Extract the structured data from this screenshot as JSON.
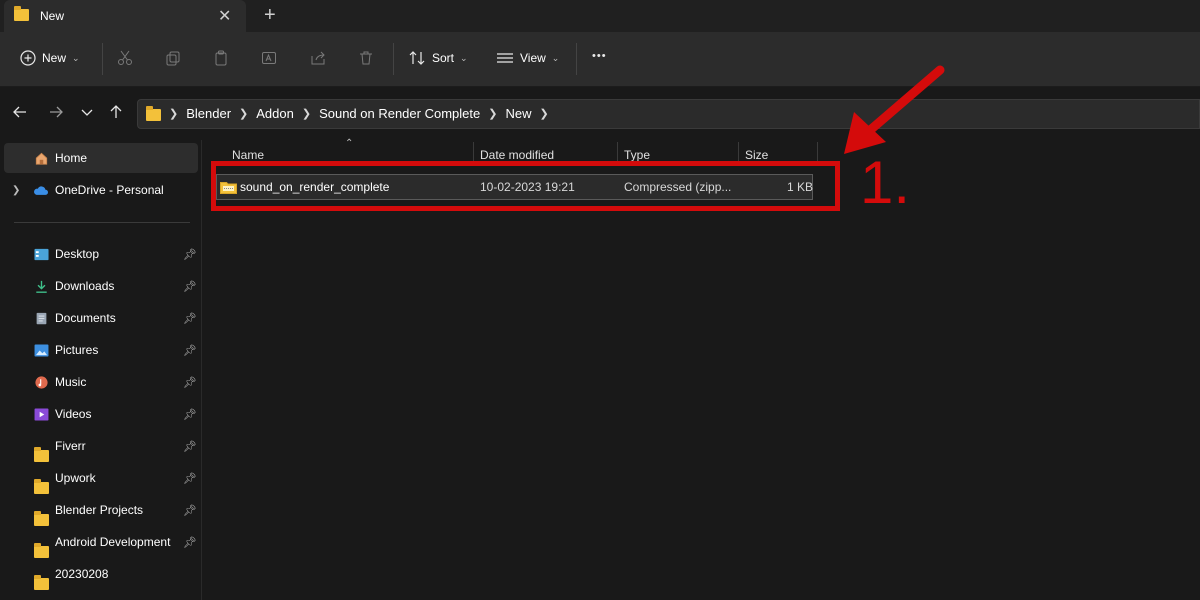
{
  "window": {
    "tab_title": "New",
    "close_glyph": "✕",
    "new_tab_glyph": "+"
  },
  "toolbar": {
    "new_label": "New",
    "sort_label": "Sort",
    "view_label": "View",
    "more_glyph": "•••"
  },
  "address": {
    "crumbs": [
      "Blender",
      "Addon",
      "Sound on Render Complete",
      "New"
    ]
  },
  "sidebar": {
    "home": "Home",
    "onedrive": "OneDrive - Personal",
    "items": [
      {
        "label": "Desktop",
        "icon": "desktop-icon"
      },
      {
        "label": "Downloads",
        "icon": "download-icon"
      },
      {
        "label": "Documents",
        "icon": "document-icon"
      },
      {
        "label": "Pictures",
        "icon": "pictures-icon"
      },
      {
        "label": "Music",
        "icon": "music-icon"
      },
      {
        "label": "Videos",
        "icon": "videos-icon"
      },
      {
        "label": "Fiverr",
        "icon": "folder-icon"
      },
      {
        "label": "Upwork",
        "icon": "folder-icon"
      },
      {
        "label": "Blender Projects",
        "icon": "folder-icon"
      },
      {
        "label": "Android Development",
        "icon": "folder-icon"
      },
      {
        "label": "20230208",
        "icon": "folder-icon"
      }
    ]
  },
  "file_list": {
    "columns": [
      "Name",
      "Date modified",
      "Type",
      "Size"
    ],
    "rows": [
      {
        "name": "sound_on_render_complete",
        "date_modified": "10-02-2023 19:21",
        "type": "Compressed (zipp...",
        "size": "1 KB"
      }
    ]
  },
  "annotation": {
    "label": "1.",
    "color": "#d40b0b"
  },
  "colors": {
    "accent_folder": "#f3c13a",
    "background": "#191919",
    "toolbar": "#2c2c2c"
  }
}
